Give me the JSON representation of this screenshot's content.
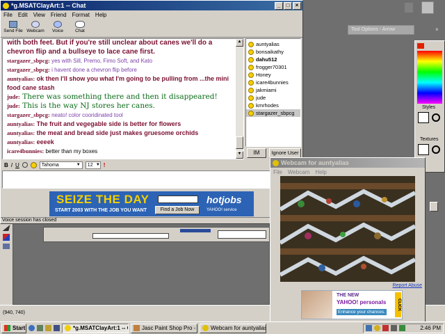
{
  "chat_window": {
    "title": "*g.MSATClayArt:1 -- Chat",
    "menu": [
      "File",
      "Edit",
      "View",
      "Friend",
      "Format",
      "Help"
    ],
    "toolbar": [
      {
        "label": "Send File",
        "icon": "send-file-icon"
      },
      {
        "label": "Webcam",
        "icon": "webcam-icon"
      },
      {
        "label": "Voice",
        "icon": "voice-icon"
      },
      {
        "label": "Chat",
        "icon": "chat-icon"
      }
    ],
    "messages": [
      {
        "nick": "",
        "text": "with both feet. But if you're still unclear about canes we'll do a chevron flip and a bullseye to lace cane first.",
        "color": "#7a1030",
        "size": "large"
      },
      {
        "nick": "stargazer_sbpcg:",
        "text": "yes with Sill, Premo, Fimo Soft, and Kato",
        "color": "#7b3fa8",
        "size": "small"
      },
      {
        "nick": "stargazer_sbpcg:",
        "text": "i havent done a chevron flip before",
        "color": "#7b3fa8",
        "size": "small"
      },
      {
        "nick": "auntyalias:",
        "text": "ok then I'll show you what I'm going to be pulling from ...the mini food cane stash",
        "color": "#7a1030",
        "size": "bold"
      },
      {
        "nick": "jude:",
        "text": "There was something there and then it disappeared!",
        "color": "#0a6a18",
        "size": "serif"
      },
      {
        "nick": "jude:",
        "text": "This is the way NJ stores her canes.",
        "color": "#0a6a18",
        "size": "serif"
      },
      {
        "nick": "stargazer_sbpcg:",
        "text": "neato! color cooridinated tool",
        "color": "#7b3fa8",
        "size": "small"
      },
      {
        "nick": "auntyalias:",
        "text": "The fruit and vegegable side is better for flowers",
        "color": "#7a1030",
        "size": "bold"
      },
      {
        "nick": "auntyalias:",
        "text": "the meat and bread side just makes gruesome orchids",
        "color": "#7a1030",
        "size": "bold"
      },
      {
        "nick": "auntyalias:",
        "text": "eeeek",
        "color": "#7a1030",
        "size": "bold"
      },
      {
        "nick": "icare4bunnies:",
        "text": "better than my boxes",
        "color": "#000000",
        "size": "small"
      }
    ],
    "buddies": [
      "auntyalias",
      "bonsaikathy",
      "dahu512",
      "frogger70301",
      "Honey",
      "icare4bunnies",
      "jakmiami",
      "jude",
      "kmrhodes",
      "stargazer_sbpcg"
    ],
    "selected_buddy": "stargazer_sbpcg",
    "im_button": "IM",
    "ignore_button": "Ignore User",
    "format": {
      "bold": "B",
      "italic": "I",
      "underline": "U",
      "font": "Tahoma",
      "size": "12"
    },
    "ad": {
      "headline": "SEIZE THE DAY",
      "subline": "START 2003 WITH THE JOB YOU WANT",
      "button": "Find a Job Now",
      "brand": "hotjobs",
      "brand_sub": "YAHOO! service"
    },
    "status": "Voice session has closed"
  },
  "tool_options": {
    "title": "Tool Options - Arrow"
  },
  "right_panel": {
    "styles": "Styles",
    "textures": "Textures"
  },
  "webcam_window": {
    "title": "Webcam for auntyalias",
    "menu": [
      "File",
      "Webcam",
      "Help"
    ],
    "report": "Report Abuse",
    "ad": {
      "line1": "THE NEW",
      "brand": "YAHOO! personals",
      "line3": "Enhance your chances.",
      "click": "CLICK"
    }
  },
  "psp_status": "(940, 740)",
  "taskbar": {
    "start": "Start",
    "tasks": [
      "*g.MSATClayArt:1 -- Chat",
      "Jasc Paint Shop Pro - Ima...",
      "Webcam for auntyalias"
    ],
    "clock": "2:46 PM"
  },
  "colors": {
    "titlebar": "#0a246a",
    "face": "#d4d0c8",
    "desktop": "#6f6f6f",
    "nick": "#7a1030",
    "ad_blue": "#1b4fa0"
  }
}
